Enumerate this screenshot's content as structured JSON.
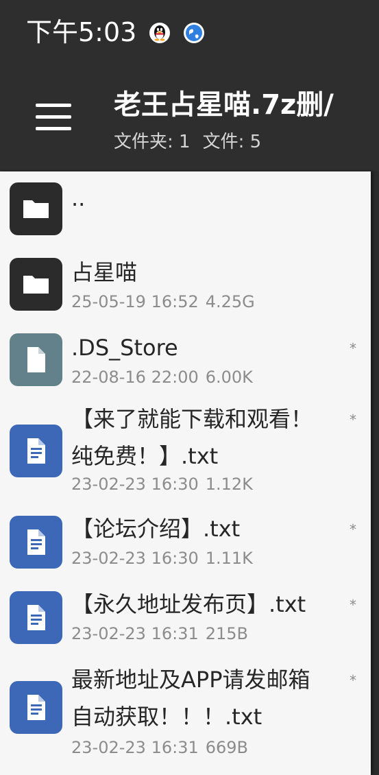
{
  "status_bar": {
    "time": "下午5:03",
    "icons": [
      "qq-penguin-icon",
      "browser-globe-icon"
    ]
  },
  "app_bar": {
    "menu_icon": "hamburger-menu-icon",
    "title": "老王占星喵.7z删/",
    "folder_count_label": "文件夹: 1",
    "file_count_label": "文件: 5"
  },
  "colors": {
    "bar_background": "#2e2e2e",
    "list_background": "#f6f6f6",
    "folder_icon_bg": "#2b2b2b",
    "generic_file_icon_bg": "#62818a",
    "text_file_icon_bg": "#3c68b7"
  },
  "files": [
    {
      "icon": "folder-icon",
      "name": "..",
      "date": "",
      "size": "",
      "mark": ""
    },
    {
      "icon": "folder-icon",
      "name": "占星喵",
      "date": "25-05-19 16:52",
      "size": "4.25G",
      "mark": ""
    },
    {
      "icon": "file-icon",
      "name": ".DS_Store",
      "date": "22-08-16 22:00",
      "size": "6.00K",
      "mark": "*"
    },
    {
      "icon": "text-file-icon",
      "name_lines": [
        "【来了就能下载和观看！",
        "纯免费！】.txt"
      ],
      "date": "23-02-23 16:30",
      "size": "1.12K",
      "mark": "*"
    },
    {
      "icon": "text-file-icon",
      "name": "【论坛介绍】.txt",
      "date": "23-02-23 16:30",
      "size": "1.11K",
      "mark": "*"
    },
    {
      "icon": "text-file-icon",
      "name": "【永久地址发布页】.txt",
      "date": "23-02-23 16:31",
      "size": "215B",
      "mark": "*"
    },
    {
      "icon": "text-file-icon",
      "name_lines": [
        "最新地址及APP请发邮箱",
        "自动获取！！！.txt"
      ],
      "date": "23-02-23 16:31",
      "size": "669B",
      "mark": "*"
    }
  ]
}
